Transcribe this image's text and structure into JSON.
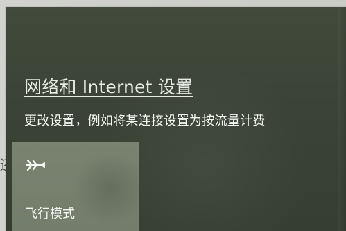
{
  "network_settings": {
    "link_text": "网络和 Internet 设置",
    "description": "更改设置，例如将某连接设置为按流量计费"
  },
  "quick_actions": {
    "airplane_mode_label": "飞行模式",
    "airplane_mode_icon": "airplane-icon"
  },
  "background": {
    "left_partial_text": "还"
  },
  "colors": {
    "panel": "#3b4438",
    "tile": "#788270",
    "text": "#f3f6f1"
  }
}
